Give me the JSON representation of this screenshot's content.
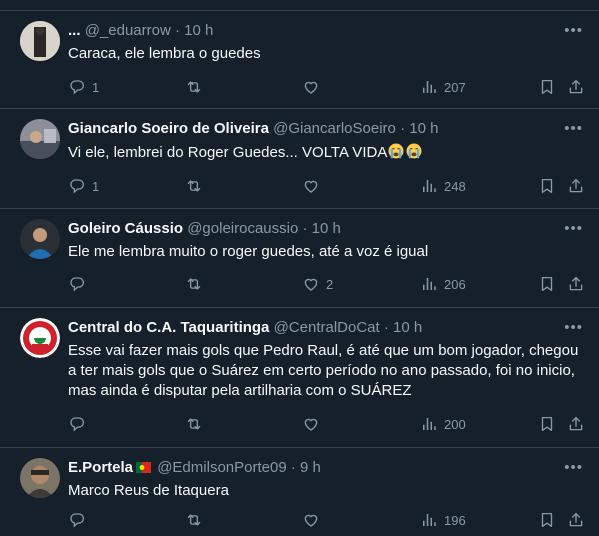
{
  "tweets": [
    {
      "name": "...",
      "handle": "@_eduarrow",
      "dot": "·",
      "time": "10 h",
      "text": "Caraca, ele lembra o guedes",
      "replies": "1",
      "retweets": "",
      "likes": "",
      "views": "207"
    },
    {
      "name": "Giancarlo Soeiro de Oliveira",
      "handle": "@GiancarloSoeiro",
      "dot": "·",
      "time": "10 h",
      "text": "Vi ele, lembrei do Roger Guedes... VOLTA VIDA",
      "replies": "1",
      "retweets": "",
      "likes": "",
      "views": "248"
    },
    {
      "name": "Goleiro Cáussio",
      "handle": "@goleirocaussio",
      "dot": "·",
      "time": "10 h",
      "text": "Ele me lembra muito o roger guedes, até a voz é igual",
      "replies": "",
      "retweets": "",
      "likes": "2",
      "views": "206"
    },
    {
      "name": "Central do C.A. Taquaritinga",
      "handle": "@CentralDoCat",
      "dot": "·",
      "time": "10 h",
      "text": "Esse vai fazer mais gols que Pedro Raul, é até que um bom jogador, chegou a ter mais gols que o Suárez em certo período no ano passado, foi no inicio, mas ainda é disputar pela artilharia com o SUÁREZ",
      "replies": "",
      "retweets": "",
      "likes": "",
      "views": "200"
    },
    {
      "name": "E.Portela",
      "handle": "@EdmilsonPorte09",
      "dot": "·",
      "time": "9 h",
      "text": "Marco Reus de Itaquera",
      "replies": "",
      "retweets": "",
      "likes": "",
      "views": "196"
    }
  ],
  "colors": {
    "background": "#15202b",
    "muted": "#8b98a5",
    "text": "#f7f9f9",
    "border": "#38444d"
  },
  "icons": [
    "more-icon",
    "reply-icon",
    "retweet-icon",
    "like-icon",
    "views-icon",
    "bookmark-icon",
    "share-icon",
    "crying-emoji-icon",
    "portugal-flag-icon"
  ]
}
